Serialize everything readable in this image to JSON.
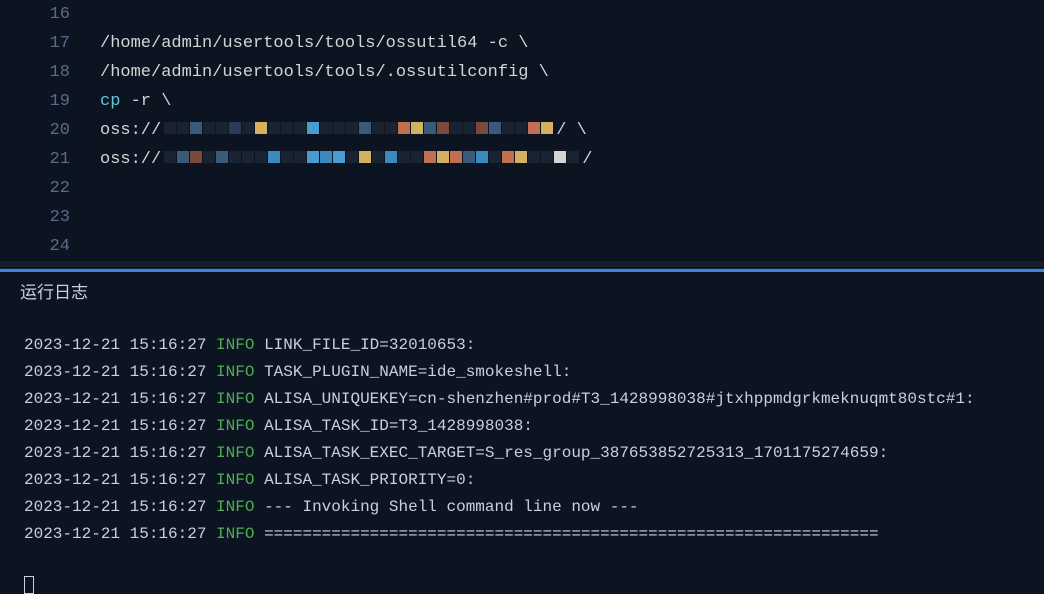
{
  "editor": {
    "lines": [
      {
        "num": "16",
        "content": ""
      },
      {
        "num": "17",
        "content": "/home/admin/usertools/tools/ossutil64 -c \\"
      },
      {
        "num": "18",
        "content": "/home/admin/usertools/tools/.ossutilconfig \\"
      },
      {
        "num": "19",
        "content_html": "<span class='cmd'>cp</span> <span class='flag'>-r</span> \\"
      },
      {
        "num": "20",
        "redacted": true,
        "prefix": "oss://",
        "suffix": "/ \\"
      },
      {
        "num": "21",
        "redacted": true,
        "prefix": "oss://",
        "suffix": "/"
      },
      {
        "num": "22",
        "content": ""
      },
      {
        "num": "23",
        "content": ""
      },
      {
        "num": "24",
        "content": ""
      }
    ]
  },
  "panel": {
    "tab_active": "运行日志"
  },
  "logs": [
    {
      "time": "2023-12-21 15:16:27",
      "level": "INFO",
      "msg": "LINK_FILE_ID=32010653:"
    },
    {
      "time": "2023-12-21 15:16:27",
      "level": "INFO",
      "msg": "TASK_PLUGIN_NAME=ide_smokeshell:"
    },
    {
      "time": "2023-12-21 15:16:27",
      "level": "INFO",
      "msg": "ALISA_UNIQUEKEY=cn-shenzhen#prod#T3_1428998038#jtxhppmdgrkmeknuqmt80stc#1:"
    },
    {
      "time": "2023-12-21 15:16:27",
      "level": "INFO",
      "msg": "ALISA_TASK_ID=T3_1428998038:"
    },
    {
      "time": "2023-12-21 15:16:27",
      "level": "INFO",
      "msg": "ALISA_TASK_EXEC_TARGET=S_res_group_387653852725313_1701175274659:"
    },
    {
      "time": "2023-12-21 15:16:27",
      "level": "INFO",
      "msg": "ALISA_TASK_PRIORITY=0:"
    },
    {
      "time": "2023-12-21 15:16:27",
      "level": "INFO",
      "msg": "--- Invoking Shell command line now ---"
    },
    {
      "time": "2023-12-21 15:16:27",
      "level": "INFO",
      "msg": "================================================================"
    }
  ],
  "redact_colors_a": [
    "#1a2332",
    "#1a2332",
    "#3a5a7a",
    "#1a2332",
    "#1a2332",
    "#2a3a5a",
    "#1a2332",
    "#d4b060",
    "#1a2332",
    "#1a2332",
    "#1a2332",
    "#4a9bd0",
    "#1a2332",
    "#1a2332",
    "#1a2332",
    "#3a5a7a",
    "#1a2332",
    "#1a2332",
    "#c07050",
    "#d4b060",
    "#3a5a7a",
    "#7a4a3a",
    "#1a2332",
    "#1a2332",
    "#7a4a3a",
    "#3a5a7a",
    "#1a2332",
    "#1a2332",
    "#c07050",
    "#d4b060"
  ],
  "redact_colors_b": [
    "#1a2332",
    "#3a5a7a",
    "#7a4a3a",
    "#1a2332",
    "#3a5a7a",
    "#1a2332",
    "#1a2332",
    "#1a2332",
    "#3a8ac0",
    "#1a2332",
    "#1a2332",
    "#4a9bd0",
    "#3a8ac0",
    "#4a9bd0",
    "#1a2332",
    "#d4b060",
    "#1a2332",
    "#3a8ac0",
    "#1a2332",
    "#1a2332",
    "#c07050",
    "#d4b060",
    "#c07050",
    "#3a5a7a",
    "#3a8ac0",
    "#1a2332",
    "#c07050",
    "#d4b060",
    "#1a2332",
    "#1a2332",
    "#d4d4d4",
    "#1a2332"
  ]
}
